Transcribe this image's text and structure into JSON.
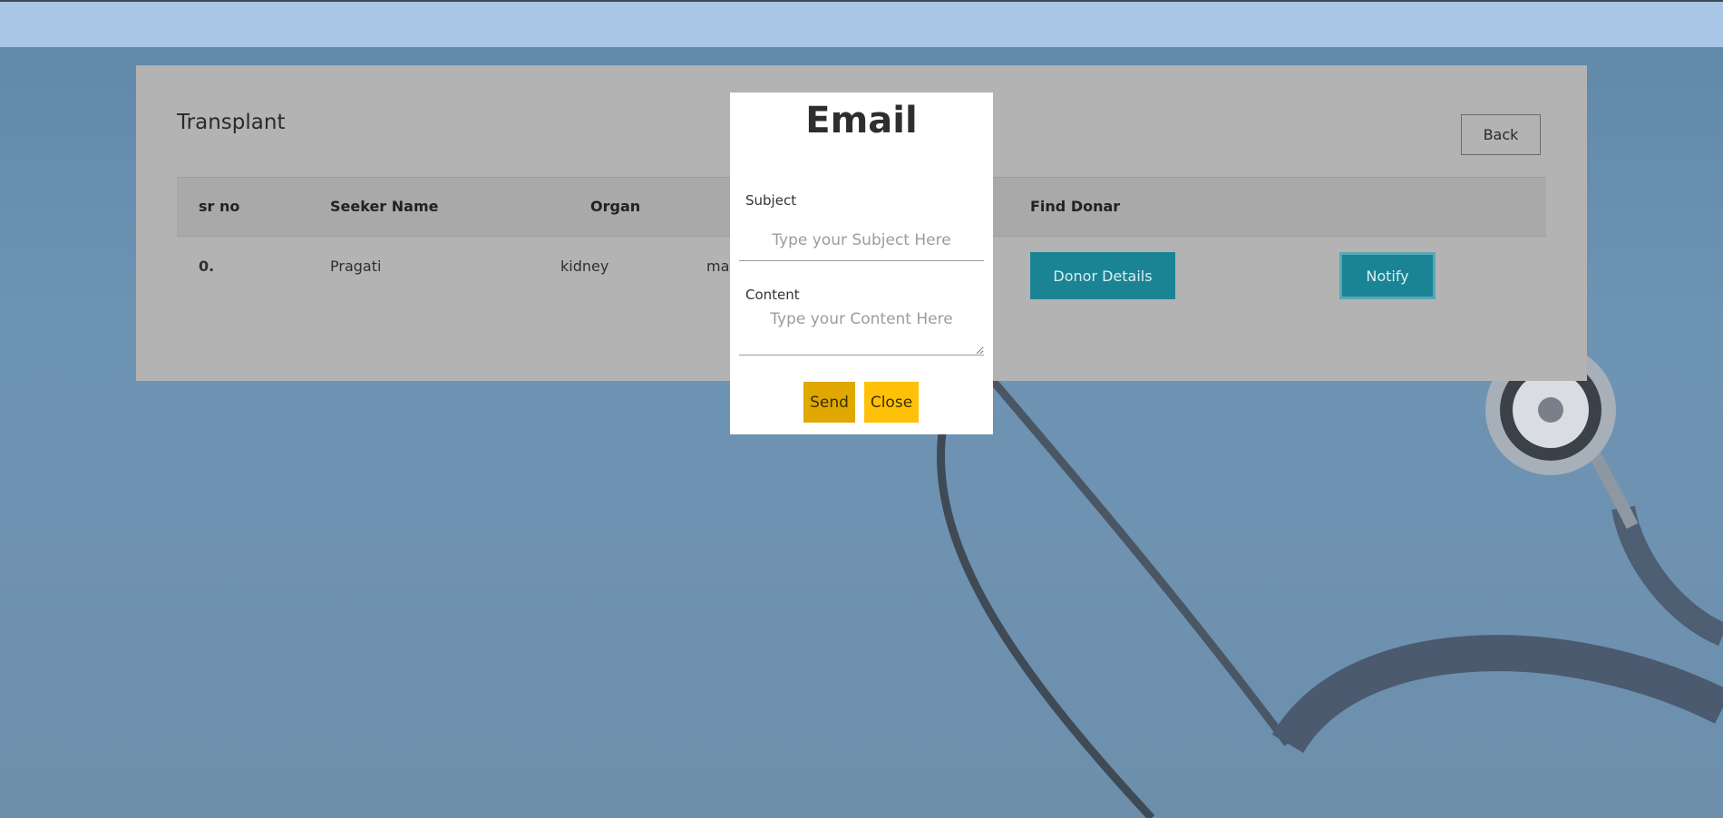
{
  "card": {
    "title": "Transplant",
    "back_label": "Back"
  },
  "table": {
    "headers": [
      "sr no",
      "Seeker Name",
      "Organ",
      "Find Donar"
    ],
    "rows": [
      {
        "sr_no": "0.",
        "seeker_name": "Pragati",
        "organ": "kidney",
        "partial": "mat",
        "donor_details_label": "Donor Details",
        "notify_label": "Notify"
      }
    ]
  },
  "modal": {
    "title": "Email",
    "subject_label": "Subject",
    "subject_placeholder": "Type your Subject Here",
    "subject_value": "",
    "content_label": "Content",
    "content_placeholder": "Type your Content Here",
    "content_value": "",
    "send_label": "Send",
    "close_label": "Close"
  },
  "colors": {
    "teal": "#1b8494",
    "send": "#e0a800",
    "close": "#ffc107"
  }
}
